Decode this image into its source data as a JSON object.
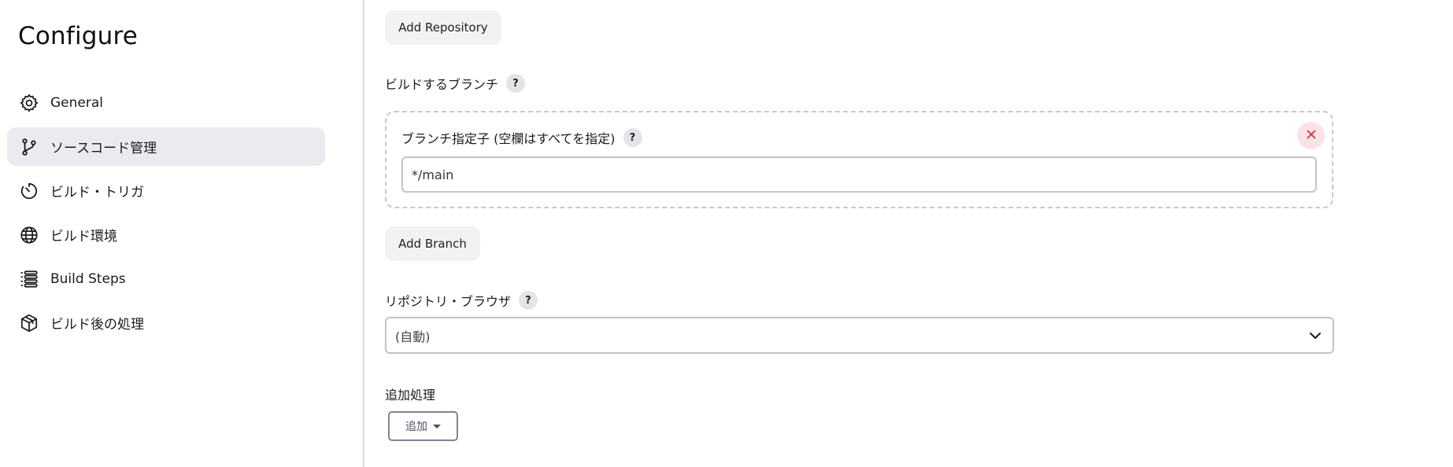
{
  "sidebar": {
    "title": "Configure",
    "items": [
      {
        "label": "General",
        "icon": "gear-icon",
        "active": false
      },
      {
        "label": "ソースコード管理",
        "icon": "git-branch-icon",
        "active": true
      },
      {
        "label": "ビルド・トリガ",
        "icon": "timer-icon",
        "active": false
      },
      {
        "label": "ビルド環境",
        "icon": "globe-icon",
        "active": false
      },
      {
        "label": "Build Steps",
        "icon": "list-icon",
        "active": false
      },
      {
        "label": "ビルド後の処理",
        "icon": "package-icon",
        "active": false
      }
    ]
  },
  "main": {
    "add_repository_label": "Add Repository",
    "branches_label": "ビルドするブランチ",
    "branch_specifier_label": "ブランチ指定子 (空欄はすべてを指定)",
    "branch_specifier_value": "*/main",
    "add_branch_label": "Add Branch",
    "repo_browser_label": "リポジトリ・ブラウザ",
    "repo_browser_selected": "(自動)",
    "additional_label": "追加処理",
    "add_dropdown_label": "追加",
    "help_glyph": "?"
  },
  "colors": {
    "active_nav_bg": "#ebebef",
    "close_bg": "#fbe3e5",
    "close_icon": "#e0313f"
  }
}
